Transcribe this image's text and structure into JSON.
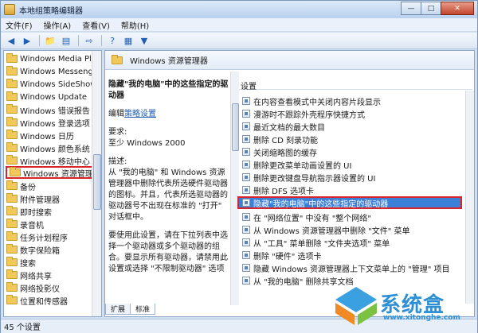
{
  "window": {
    "title": "本地组策略编辑器",
    "minimize": "—",
    "maximize": "□",
    "close": "✕"
  },
  "menu": [
    "文件(F)",
    "操作(A)",
    "查看(V)",
    "帮助(H)"
  ],
  "tree": {
    "items": [
      "Windows Media Play",
      "Windows Messenge",
      "Windows SideShow",
      "Windows Update",
      "Windows 错误报告",
      "Windows 登录选项",
      "Windows 日历",
      "Windows 颜色系统",
      "Windows 移动中心",
      "Windows 资源管理器",
      "备份",
      "附件管理器",
      "即时搜索",
      "录音机",
      "任务计划程序",
      "数字保险箱",
      "搜索",
      "网络共享",
      "网络投影仪",
      "位置和传感器"
    ],
    "selected": "Windows 资源管理器"
  },
  "right": {
    "header": "Windows 资源管理器",
    "desc": {
      "title": "隐藏\"我的电脑\"中的这些指定的驱动器",
      "edit_prefix": "编辑",
      "edit_link": "策略设置",
      "req_label": "要求:",
      "req_value": "至少 Windows 2000",
      "desc_label": "描述:",
      "desc_text": "从 \"我的电脑\" 和 Windows 资源管理器中删除代表所选硬件驱动器的图标。并且，代表所选驱动器的驱动器号不出现在标准的 \"打开\" 对话框中。",
      "usage_text": "要使用此设置，请在下拉列表中选择一个驱动器或多个驱动器的组合。要显示所有驱动器，请禁用此设置或选择 \"不限制驱动器\" 选项"
    },
    "settings_header": "设置",
    "settings": [
      "在内容查看模式中关闭内容片段显示",
      "漫游时不跟踪外壳程序快捷方式",
      "最近文档的最大数目",
      "删除 CD 刻录功能",
      "关闭缩略图的缓存",
      "删除更改菜单动画设置的 UI",
      "删除更改键盘导航指示器设置的 UI",
      "删除 DFS 选项卡",
      "隐藏\"我的电脑\"中的这些指定的驱动器",
      "在 \"网络位置\" 中没有 \"整个网络\"",
      "从 Windows 资源管理器中删除 \"文件\" 菜单",
      "从 \"工具\" 菜单删除 \"文件夹选项\" 菜单",
      "删除 \"硬件\" 选项卡",
      "隐藏 Windows 资源管理器上下文菜单上的 \"管理\" 项目",
      "从 \"我的电脑\" 删除共享文档"
    ],
    "selected_setting": "隐藏\"我的电脑\"中的这些指定的驱动器",
    "tabs": [
      "扩展",
      "标准"
    ]
  },
  "status": "45 个设置",
  "watermark": {
    "text": "系统盒",
    "url": "www.xitonghe.com"
  },
  "colors": {
    "accent": "#3c7fd7",
    "highlight_border": "#d8242a",
    "link": "#1c5ab2"
  }
}
